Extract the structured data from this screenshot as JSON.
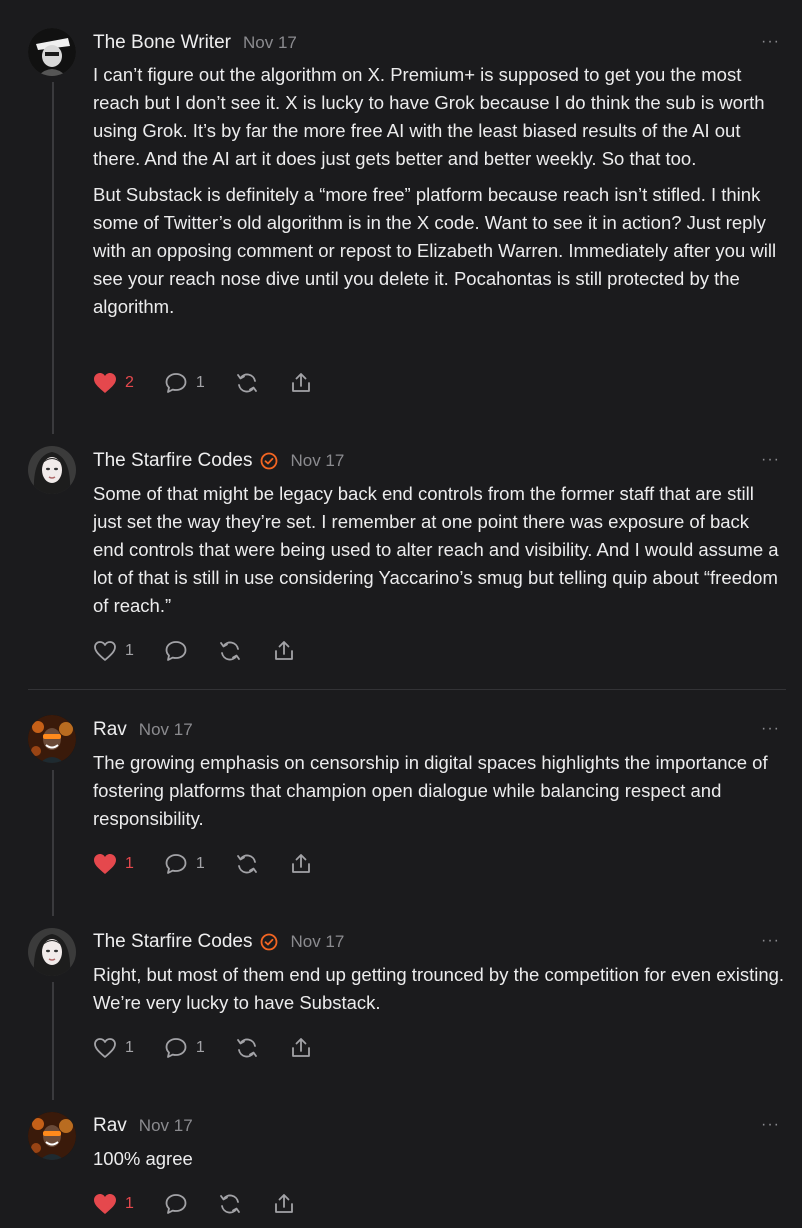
{
  "colors": {
    "background": "#1b1b1d",
    "text": "#ececed",
    "muted": "#8b8b8f",
    "like_active": "#e5484d",
    "verified": "#f26522"
  },
  "comments": [
    {
      "author": "The Bone Writer",
      "date": "Nov 17",
      "verified": false,
      "more": "···",
      "paragraphs": [
        "I can’t figure out the algorithm on X. Premium+ is supposed to get you the most reach but I don’t see it. X is lucky to have Grok because I do think the sub is worth using Grok. It’s by far the more free AI with the least biased results of the AI out there. And the AI art it does just gets better and better weekly. So that too.",
        "But Substack is definitely a “more free” platform because reach isn’t stifled. I think some of Twitter’s old algorithm is in the X code. Want to see it in action? Just reply with an opposing comment or repost to Elizabeth Warren. Immediately after you will see your reach nose dive until you delete it. Pocahontas is still protected by the algorithm."
      ],
      "likes": "2",
      "liked": true,
      "replies": "1"
    },
    {
      "author": "The Starfire Codes",
      "date": "Nov 17",
      "verified": true,
      "more": "···",
      "paragraphs": [
        "Some of that might be legacy back end controls from the former staff that are still just set the way they’re set. I remember at one point there was exposure of back end controls that were being used to alter reach and visibility. And I would assume a lot of that is still in use considering Yaccarino’s smug but telling quip about “freedom of reach.”"
      ],
      "likes": "1",
      "liked": false,
      "replies": ""
    },
    {
      "author": "Rav",
      "date": "Nov 17",
      "verified": false,
      "more": "···",
      "paragraphs": [
        "The growing emphasis on censorship in digital spaces highlights the importance of fostering platforms that champion open dialogue while balancing respect and responsibility."
      ],
      "likes": "1",
      "liked": true,
      "replies": "1"
    },
    {
      "author": "The Starfire Codes",
      "date": "Nov 17",
      "verified": true,
      "more": "···",
      "paragraphs": [
        "Right, but most of them end up getting trounced by the competition for even existing. We’re very lucky to have Substack."
      ],
      "likes": "1",
      "liked": false,
      "replies": "1"
    },
    {
      "author": "Rav",
      "date": "Nov 17",
      "verified": false,
      "more": "···",
      "paragraphs": [
        "100% agree"
      ],
      "likes": "1",
      "liked": true,
      "replies": ""
    }
  ]
}
